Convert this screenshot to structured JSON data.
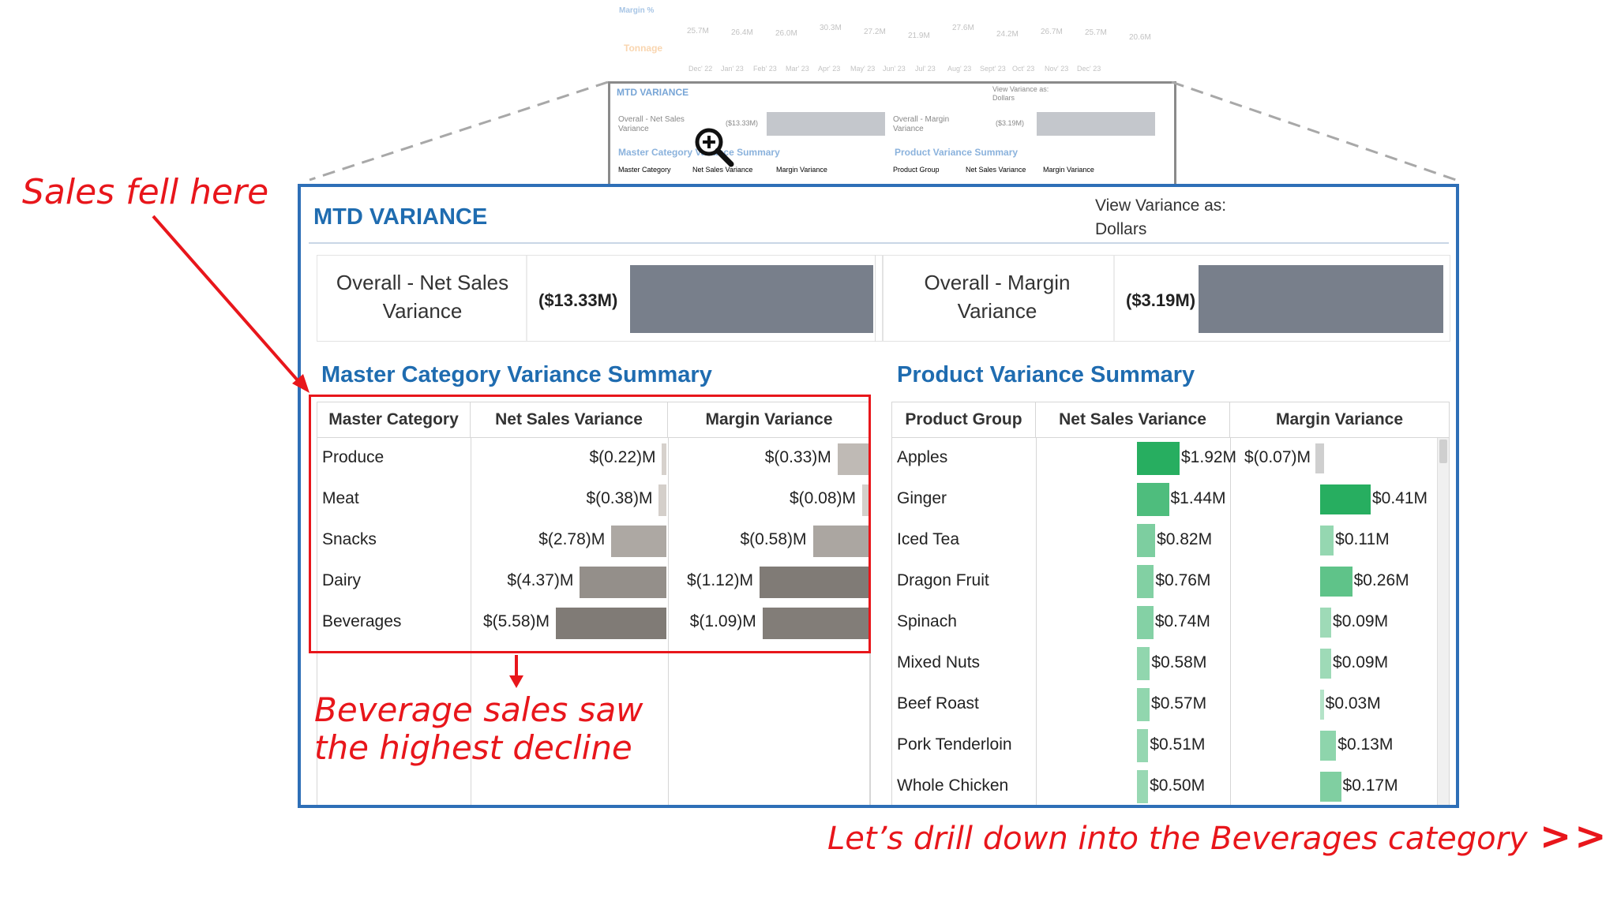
{
  "background_preview": {
    "margin_label": "Margin %",
    "tonnage_label": "Tonnage",
    "tonnage_values": [
      "25.7M",
      "26.4M",
      "26.0M",
      "30.3M",
      "27.2M",
      "21.9M",
      "27.6M",
      "24.2M",
      "26.7M",
      "25.7M",
      "20.6M"
    ],
    "months": [
      "Dec' 22",
      "Jan' 23",
      "Feb' 23",
      "Mar' 23",
      "Apr' 23",
      "May' 23",
      "Jun' 23",
      "Jul' 23",
      "Aug' 23",
      "Sept' 23",
      "Oct' 23",
      "Nov' 23",
      "Dec' 23"
    ],
    "thumb_title": "MTD VARIANCE",
    "thumb_view_label": "View Variance as:",
    "thumb_view_value": "Dollars",
    "thumb_net_sales_label": "Overall - Net Sales Variance",
    "thumb_net_sales_value": "($13.33M)",
    "thumb_margin_label": "Overall - Margin Variance",
    "thumb_margin_value": "($3.19M)",
    "thumb_master_title": "Master Category Variance Summary",
    "thumb_product_title": "Product Variance Summary",
    "thumb_headers": [
      "Master Category",
      "Net Sales Variance",
      "Margin Variance",
      "Product Group",
      "Net Sales Variance",
      "Margin Variance"
    ]
  },
  "panel": {
    "title": "MTD VARIANCE",
    "view_label": "View Variance as:",
    "view_value": "Dollars",
    "kpis": [
      {
        "label_line1": "Overall - Net Sales",
        "label_line2": "Variance",
        "value": "($13.33M)"
      },
      {
        "label_line1": "Overall - Margin",
        "label_line2": "Variance",
        "value": "($3.19M)"
      }
    ]
  },
  "master_table": {
    "title": "Master Category Variance Summary",
    "headers": [
      "Master Category",
      "Net Sales Variance",
      "Margin Variance"
    ],
    "rows": [
      {
        "category": "Produce",
        "net_sales": "$(0.22)M",
        "net_sales_value": -0.22,
        "margin": "$(0.33)M",
        "margin_value": -0.33
      },
      {
        "category": "Meat",
        "net_sales": "$(0.38)M",
        "net_sales_value": -0.38,
        "margin": "$(0.08)M",
        "margin_value": -0.08
      },
      {
        "category": "Snacks",
        "net_sales": "$(2.78)M",
        "net_sales_value": -2.78,
        "margin": "$(0.58)M",
        "margin_value": -0.58
      },
      {
        "category": "Dairy",
        "net_sales": "$(4.37)M",
        "net_sales_value": -4.37,
        "margin": "$(1.12)M",
        "margin_value": -1.12
      },
      {
        "category": "Beverages",
        "net_sales": "$(5.58)M",
        "net_sales_value": -5.58,
        "margin": "$(1.09)M",
        "margin_value": -1.09
      }
    ]
  },
  "product_table": {
    "title": "Product Variance Summary",
    "headers": [
      "Product Group",
      "Net Sales Variance",
      "Margin Variance"
    ],
    "rows": [
      {
        "product": "Apples",
        "net_sales": "$1.92M",
        "net_sales_value": 1.92,
        "margin": "$(0.07)M",
        "margin_value": -0.07
      },
      {
        "product": "Ginger",
        "net_sales": "$1.44M",
        "net_sales_value": 1.44,
        "margin": "$0.41M",
        "margin_value": 0.41
      },
      {
        "product": "Iced Tea",
        "net_sales": "$0.82M",
        "net_sales_value": 0.82,
        "margin": "$0.11M",
        "margin_value": 0.11
      },
      {
        "product": "Dragon Fruit",
        "net_sales": "$0.76M",
        "net_sales_value": 0.76,
        "margin": "$0.26M",
        "margin_value": 0.26
      },
      {
        "product": "Spinach",
        "net_sales": "$0.74M",
        "net_sales_value": 0.74,
        "margin": "$0.09M",
        "margin_value": 0.09
      },
      {
        "product": "Mixed Nuts",
        "net_sales": "$0.58M",
        "net_sales_value": 0.58,
        "margin": "$0.09M",
        "margin_value": 0.09
      },
      {
        "product": "Beef Roast",
        "net_sales": "$0.57M",
        "net_sales_value": 0.57,
        "margin": "$0.03M",
        "margin_value": 0.03
      },
      {
        "product": "Pork Tenderloin",
        "net_sales": "$0.51M",
        "net_sales_value": 0.51,
        "margin": "$0.13M",
        "margin_value": 0.13
      },
      {
        "product": "Whole Chicken",
        "net_sales": "$0.50M",
        "net_sales_value": 0.5,
        "margin": "$0.17M",
        "margin_value": 0.17
      }
    ]
  },
  "annotations": {
    "sales_fell": "Sales fell here",
    "beverage_line1": "Beverage sales saw",
    "beverage_line2": "the highest decline",
    "drill_down": "Let’s drill down into the Beverages category",
    "drill_arrow": ">>"
  },
  "colors": {
    "accent_blue": "#1f6cb0",
    "panel_border": "#2e6fb7",
    "annotation_red": "#e8161b",
    "kpi_bar": "#787f8b",
    "positive_green": "#27ae60"
  }
}
